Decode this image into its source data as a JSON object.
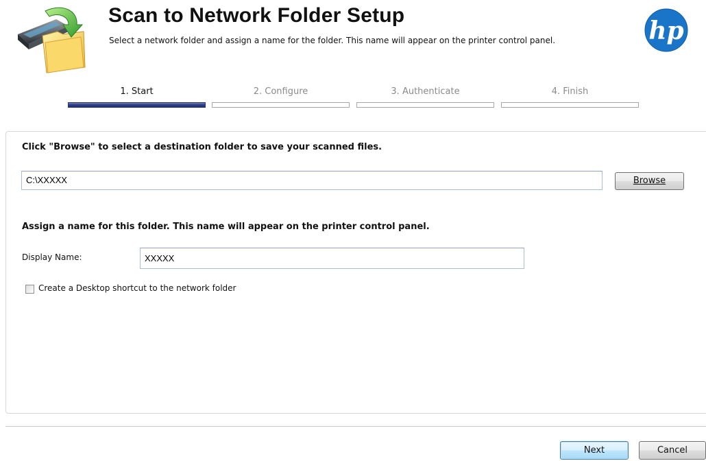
{
  "header": {
    "title": "Scan to Network Folder Setup",
    "subtitle": "Select a network folder and assign a name for the folder. This name will appear on the printer control panel.",
    "logo_text": "hp",
    "brand_color": "#1a75c9"
  },
  "steps": [
    {
      "label": "1. Start",
      "active": true
    },
    {
      "label": "2. Configure",
      "active": false
    },
    {
      "label": "3. Authenticate",
      "active": false
    },
    {
      "label": "4. Finish",
      "active": false
    }
  ],
  "folder_section": {
    "instruction": "Click \"Browse\" to select a destination folder to save your scanned files.",
    "path_value": "C:\\XXXXX",
    "browse_label": "Browse"
  },
  "name_section": {
    "instruction": "Assign a name for this folder. This name will appear on the printer control panel.",
    "display_name_label": "Display Name:",
    "display_name_value": "XXXXX"
  },
  "shortcut": {
    "label": "Create a Desktop shortcut to the network folder",
    "checked": false
  },
  "footer": {
    "next_label": "Next",
    "cancel_label": "Cancel"
  },
  "icons": {
    "app": "scan-to-folder-icon",
    "logo": "hp-logo"
  }
}
